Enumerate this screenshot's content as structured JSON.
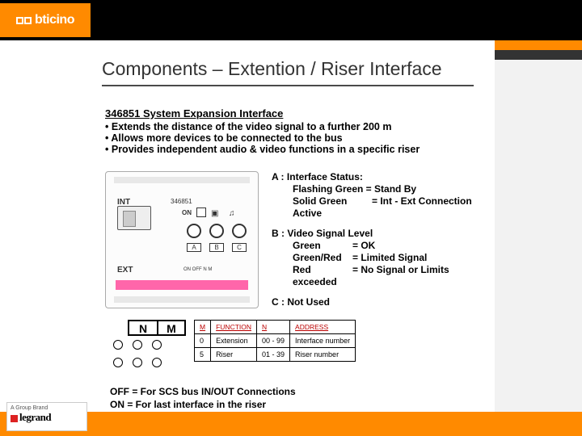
{
  "brand": "bticino",
  "title": "Components – Extention / Riser Interface",
  "product_heading": "346851 System Expansion Interface",
  "features": [
    "Extends the distance of the video signal to a further 200 m",
    "Allows more devices to be connected to the bus",
    "Provides independent audio & video functions in a specific riser"
  ],
  "device": {
    "model": "346851",
    "port_int": "INT",
    "port_ext": "EXT",
    "on_label": "ON",
    "led_a": "A",
    "led_b": "B",
    "led_c": "C",
    "ext_small": "ON  OFF   N    M"
  },
  "legend": {
    "a_prefix": "A :",
    "a_title": "Interface Status:",
    "a_line1": "Flashing Green = Stand By",
    "a_line2a": "Solid Green",
    "a_line2b": "= Int - Ext Connection Active",
    "b_prefix": "B :",
    "b_title": "Video Signal Level",
    "b_l1a": "Green",
    "b_l1b": "= OK",
    "b_l2a": "Green/Red",
    "b_l2b": "= Limited Signal",
    "b_l3a": "Red",
    "b_l3b": "= No Signal or Limits exceeded",
    "c_prefix": "C :",
    "c_title": "Not Used"
  },
  "nm": {
    "n": "N",
    "m": "M"
  },
  "table": {
    "headers": [
      "M",
      "FUNCTION",
      "N",
      "ADDRESS"
    ],
    "rows": [
      [
        "0",
        "Extension",
        "00 - 99",
        "Interface number"
      ],
      [
        "5",
        "Riser",
        "01 - 39",
        "Riser number"
      ]
    ]
  },
  "footnote": {
    "off": "OFF = For SCS bus IN/OUT Connections",
    "on": "ON  = For last interface in the riser"
  },
  "footer": {
    "group": "A Group Brand",
    "legrand": "legrand"
  }
}
